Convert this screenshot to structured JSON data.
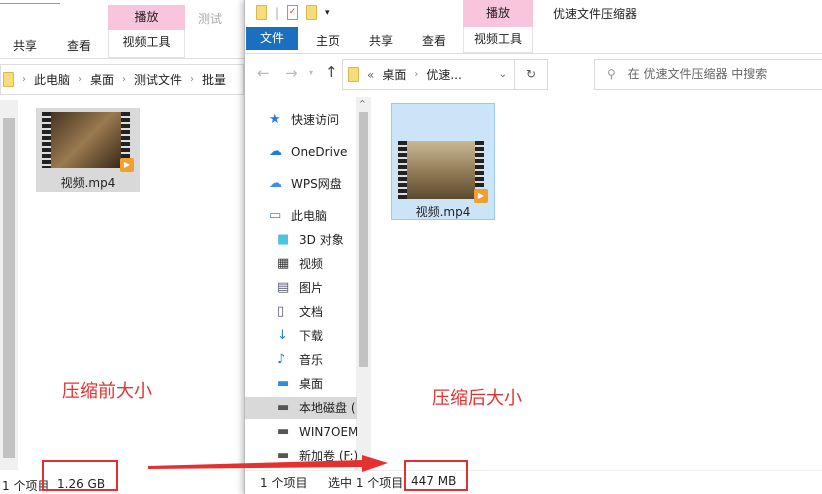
{
  "left_window": {
    "ribbon": {
      "context_header": "播放",
      "context_tab": "视频工具",
      "faded_title": "测试",
      "tabs": [
        "共享",
        "查看"
      ]
    },
    "breadcrumb": [
      "此电脑",
      "桌面",
      "测试文件",
      "批量"
    ],
    "file": {
      "name": "视频.mp4"
    },
    "status": {
      "count": "1 个项目",
      "size": "1.26 GB"
    }
  },
  "right_window": {
    "title": "优速文件压缩器",
    "ribbon": {
      "context_header": "播放",
      "context_tab": "视频工具",
      "file_tab": "文件",
      "tabs": [
        "主页",
        "共享",
        "查看"
      ]
    },
    "address": {
      "prefix": "«",
      "parts": [
        "桌面",
        "优速..."
      ]
    },
    "search": {
      "placeholder": "在 优速文件压缩器 中搜索"
    },
    "nav": [
      {
        "label": "快速访问",
        "icon": "star-icon"
      },
      {
        "label": "OneDrive",
        "icon": "cloud-icon"
      },
      {
        "label": "WPS网盘",
        "icon": "wps-cloud-icon"
      },
      {
        "label": "此电脑",
        "icon": "computer-icon"
      },
      {
        "label": "3D 对象",
        "icon": "cube-icon"
      },
      {
        "label": "视频",
        "icon": "video-icon"
      },
      {
        "label": "图片",
        "icon": "picture-icon"
      },
      {
        "label": "文档",
        "icon": "document-icon"
      },
      {
        "label": "下载",
        "icon": "download-icon"
      },
      {
        "label": "音乐",
        "icon": "music-icon"
      },
      {
        "label": "桌面",
        "icon": "desktop-icon"
      },
      {
        "label": "本地磁盘 (",
        "icon": "disk-icon"
      },
      {
        "label": "WIN7OEM",
        "icon": "drive-icon"
      },
      {
        "label": "新加卷 (F:)",
        "icon": "drive-icon"
      }
    ],
    "file": {
      "name": "视频.mp4"
    },
    "status": {
      "count": "1 个项目",
      "selected": "选中 1 个项目",
      "size": "447 MB"
    }
  },
  "annotations": {
    "before": "压缩前大小",
    "after": "压缩后大小"
  },
  "colors": {
    "accent": "#1a6fbf",
    "context": "#f9c5dc",
    "annotation": "#e53030"
  }
}
